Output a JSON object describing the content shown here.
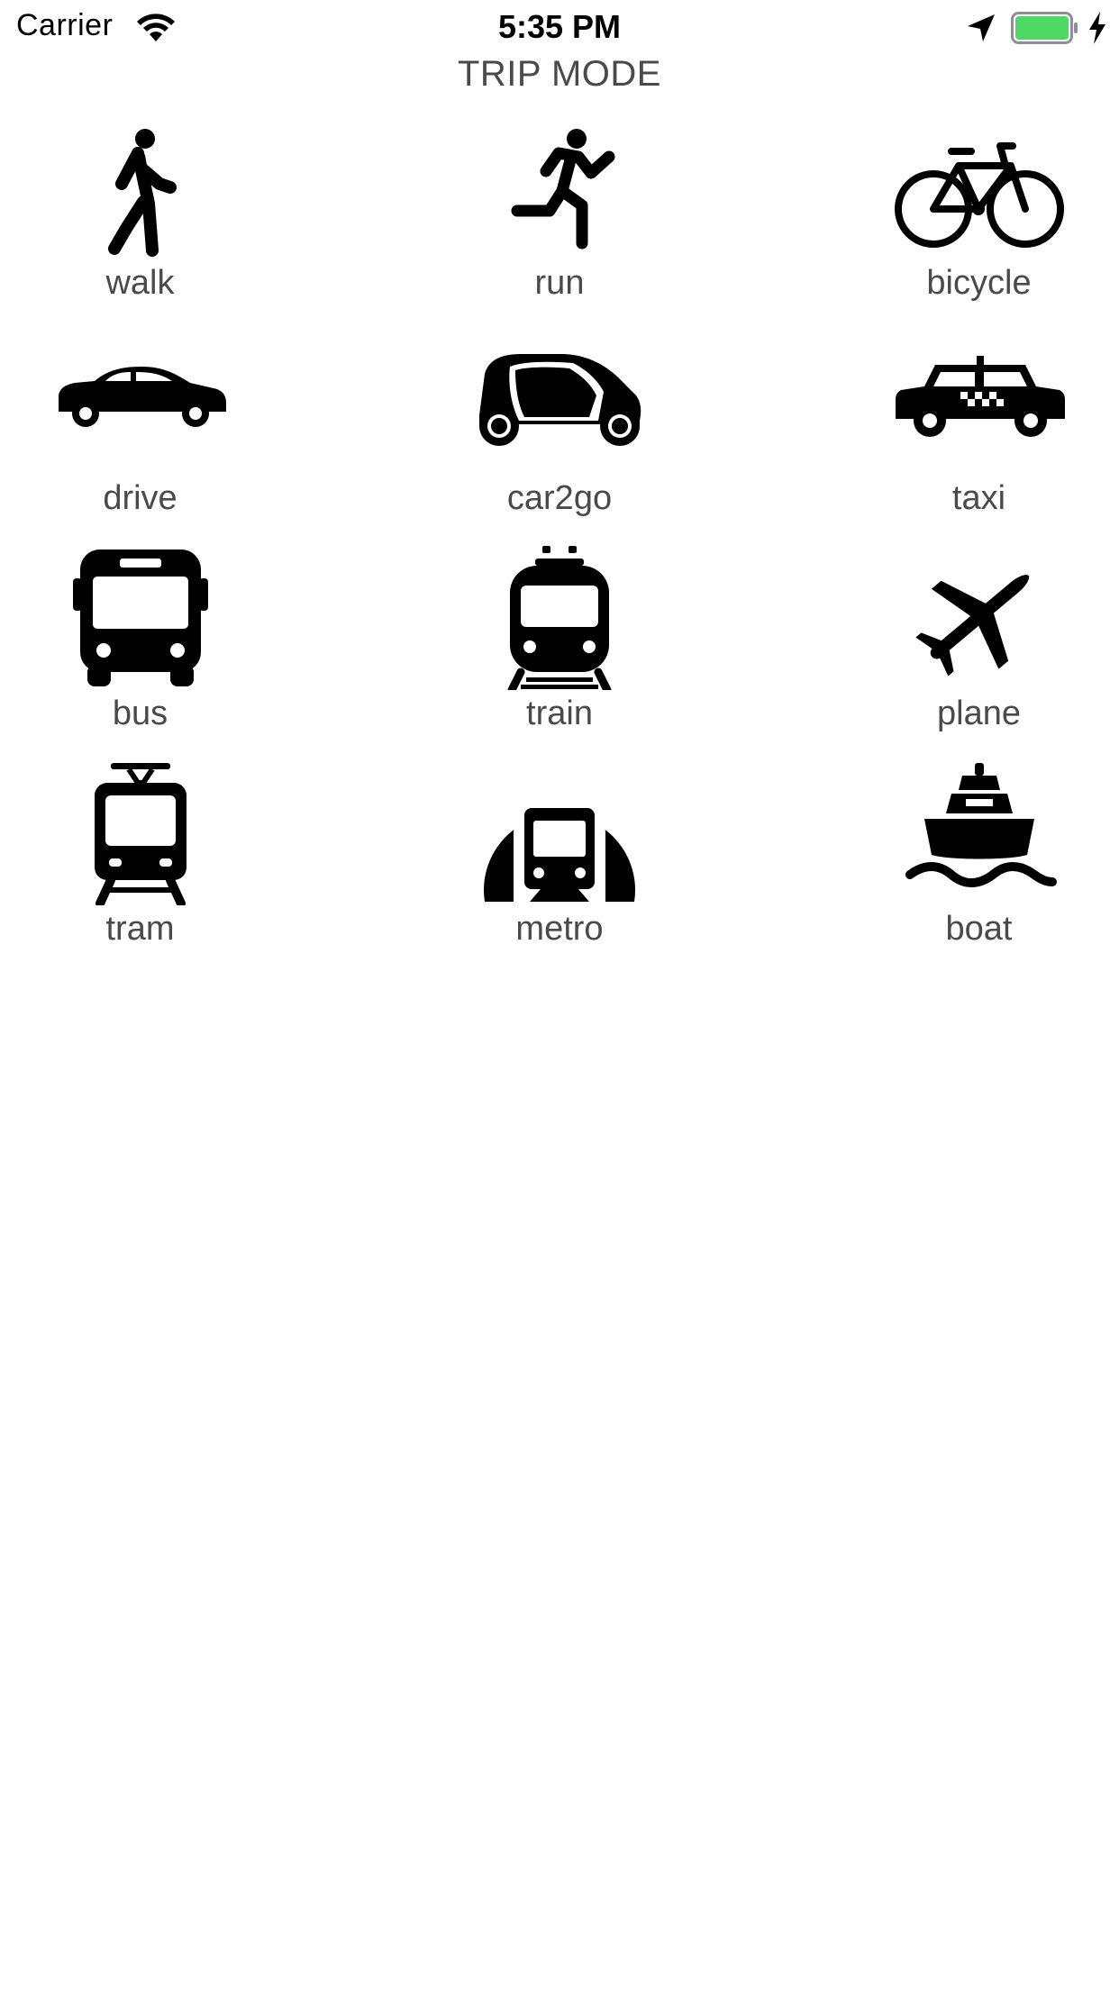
{
  "status_bar": {
    "carrier": "Carrier",
    "time": "5:35 PM",
    "battery_color": "#4cd964"
  },
  "title": "TRIP MODE",
  "modes": [
    {
      "label": "walk",
      "icon": "walk-icon"
    },
    {
      "label": "run",
      "icon": "run-icon"
    },
    {
      "label": "bicycle",
      "icon": "bicycle-icon"
    },
    {
      "label": "drive",
      "icon": "car-icon"
    },
    {
      "label": "car2go",
      "icon": "smart-car-icon"
    },
    {
      "label": "taxi",
      "icon": "taxi-icon"
    },
    {
      "label": "bus",
      "icon": "bus-icon"
    },
    {
      "label": "train",
      "icon": "train-icon"
    },
    {
      "label": "plane",
      "icon": "plane-icon"
    },
    {
      "label": "tram",
      "icon": "tram-icon"
    },
    {
      "label": "metro",
      "icon": "metro-icon"
    },
    {
      "label": "boat",
      "icon": "boat-icon"
    }
  ]
}
